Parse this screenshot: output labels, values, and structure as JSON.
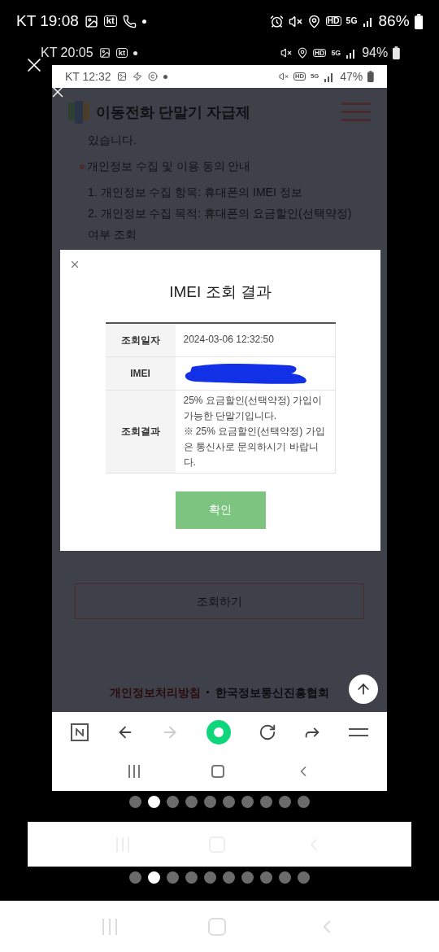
{
  "device_status_bar": {
    "carrier_time": "KT 19:08",
    "kt_badge": "kt",
    "hd": "HD",
    "network": "5G",
    "battery": "86%"
  },
  "viewer_status_bar": {
    "carrier_time": "KT 20:05",
    "kt_badge": "kt",
    "hd": "HD",
    "network": "5G",
    "battery": "94%"
  },
  "screenshot": {
    "status_bar": {
      "carrier_time": "KT 12:32",
      "hd": "HD",
      "network": "5G",
      "battery": "47%"
    },
    "site_title": "이동전화 단말기 자급제",
    "page_lines": [
      {
        "kind": "text",
        "text": "있습니다."
      },
      {
        "kind": "heading",
        "text": "개인정보 수집 및 이용 동의 안내"
      },
      {
        "kind": "text",
        "text": "1. 개인정보 수집 항목: 휴대폰의 IMEI 정보"
      },
      {
        "kind": "text",
        "text": "2. 개인정보 수집 목적: 휴대폰의 요금할인(선택약정)"
      },
      {
        "kind": "text",
        "text": "여부 조회"
      }
    ],
    "lookup_button": "조회하기",
    "footer": {
      "privacy_link": "개인정보처리방침",
      "separator": "·",
      "org_link": "한국정보통신진흥협회"
    },
    "dialog": {
      "title": "IMEI 조회 결과",
      "rows": [
        {
          "label": "조회일자",
          "redacted": false,
          "lines": [
            "2024-03-06 12:32:50"
          ]
        },
        {
          "label": "IMEI",
          "redacted": true
        },
        {
          "label": "조회결과",
          "redacted": false,
          "lines": [
            "25% 요금할인(선택약정) 가입이 가능한 단말기입니다.",
            "※ 25% 요금할인(선택약정) 가입은 통신사로 문의하시기 바랍니다."
          ]
        }
      ],
      "confirm_button": "확인"
    },
    "toolbar": {
      "forward_disabled": true
    }
  },
  "pages": [
    {
      "selected": false
    },
    {
      "selected": true
    },
    {
      "selected": false
    },
    {
      "selected": false
    },
    {
      "selected": false
    },
    {
      "selected": false
    },
    {
      "selected": false
    },
    {
      "selected": false
    },
    {
      "selected": false
    },
    {
      "selected": false
    }
  ],
  "pages_lower": [
    {
      "selected": false
    },
    {
      "selected": true
    },
    {
      "selected": false
    },
    {
      "selected": false
    },
    {
      "selected": false
    },
    {
      "selected": false
    },
    {
      "selected": false
    },
    {
      "selected": false
    },
    {
      "selected": false
    },
    {
      "selected": false
    }
  ]
}
